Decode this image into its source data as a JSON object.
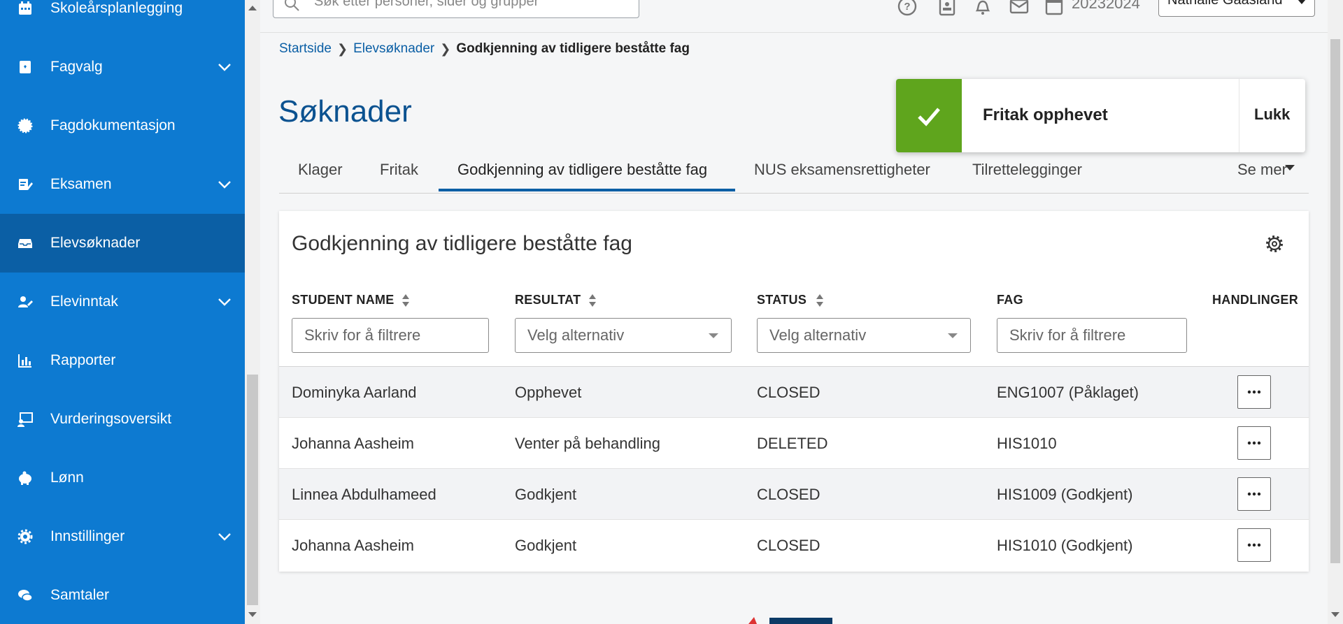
{
  "sidebar": {
    "items": [
      {
        "label": "Skoleårsplanlegging",
        "icon": "calendar-icon",
        "has_chevron": false
      },
      {
        "label": "Fagvalg",
        "icon": "book-icon",
        "has_chevron": true
      },
      {
        "label": "Fagdokumentasjon",
        "icon": "badge-icon",
        "has_chevron": false
      },
      {
        "label": "Eksamen",
        "icon": "edit-document-icon",
        "has_chevron": true
      },
      {
        "label": "Elevsøknader",
        "icon": "inbox-icon",
        "has_chevron": false,
        "active": true
      },
      {
        "label": "Elevinntak",
        "icon": "user-edit-icon",
        "has_chevron": true
      },
      {
        "label": "Rapporter",
        "icon": "bar-chart-icon",
        "has_chevron": false
      },
      {
        "label": "Vurderingsoversikt",
        "icon": "presentation-icon",
        "has_chevron": false
      },
      {
        "label": "Lønn",
        "icon": "piggy-bank-icon",
        "has_chevron": false
      },
      {
        "label": "Innstillinger",
        "icon": "gear-icon",
        "has_chevron": true
      },
      {
        "label": "Samtaler",
        "icon": "chat-icon",
        "has_chevron": false
      }
    ],
    "colors": {
      "background": "#0d7ad1",
      "active": "#0b5fa5"
    }
  },
  "topbar": {
    "search_placeholder": "Søk etter personer, sider og grupper",
    "year": "20232024",
    "user": "Nathalie Gaasland",
    "icons": [
      "help-icon",
      "contacts-icon",
      "bell-icon",
      "mail-icon",
      "calendar-icon"
    ]
  },
  "breadcrumb": {
    "items": [
      "Startside",
      "Elevsøknader"
    ],
    "current": "Godkjenning av tidligere beståtte fag"
  },
  "page": {
    "title": "Søknader"
  },
  "toast": {
    "message": "Fritak opphevet",
    "close_label": "Lukk",
    "color": "#5fa51d"
  },
  "tabs": {
    "items": [
      "Klager",
      "Fritak",
      "Godkjenning av tidligere beståtte fag",
      "NUS eksamensrettigheter",
      "Tilrettelegginger"
    ],
    "active_index": 2,
    "more_label": "Se mer"
  },
  "card": {
    "title": "Godkjenning av tidligere beståtte fag",
    "columns": [
      "STUDENT NAME",
      "RESULTAT",
      "STATUS",
      "FAG",
      "HANDLINGER"
    ],
    "filters": {
      "student_placeholder": "Skriv for å filtrere",
      "resultat_placeholder": "Velg alternativ",
      "status_placeholder": "Velg alternativ",
      "fag_placeholder": "Skriv for å filtrere"
    },
    "rows": [
      {
        "name": "Dominyka Aarland",
        "resultat": "Opphevet",
        "status": "CLOSED",
        "fag": "ENG1007 (Påklaget)"
      },
      {
        "name": "Johanna Aasheim",
        "resultat": "Venter på behandling",
        "status": "DELETED",
        "fag": "HIS1010"
      },
      {
        "name": "Linnea Abdulhameed",
        "resultat": "Godkjent",
        "status": "CLOSED",
        "fag": "HIS1009 (Godkjent)"
      },
      {
        "name": "Johanna Aasheim",
        "resultat": "Godkjent",
        "status": "CLOSED",
        "fag": "HIS1010 (Godkjent)"
      }
    ]
  }
}
